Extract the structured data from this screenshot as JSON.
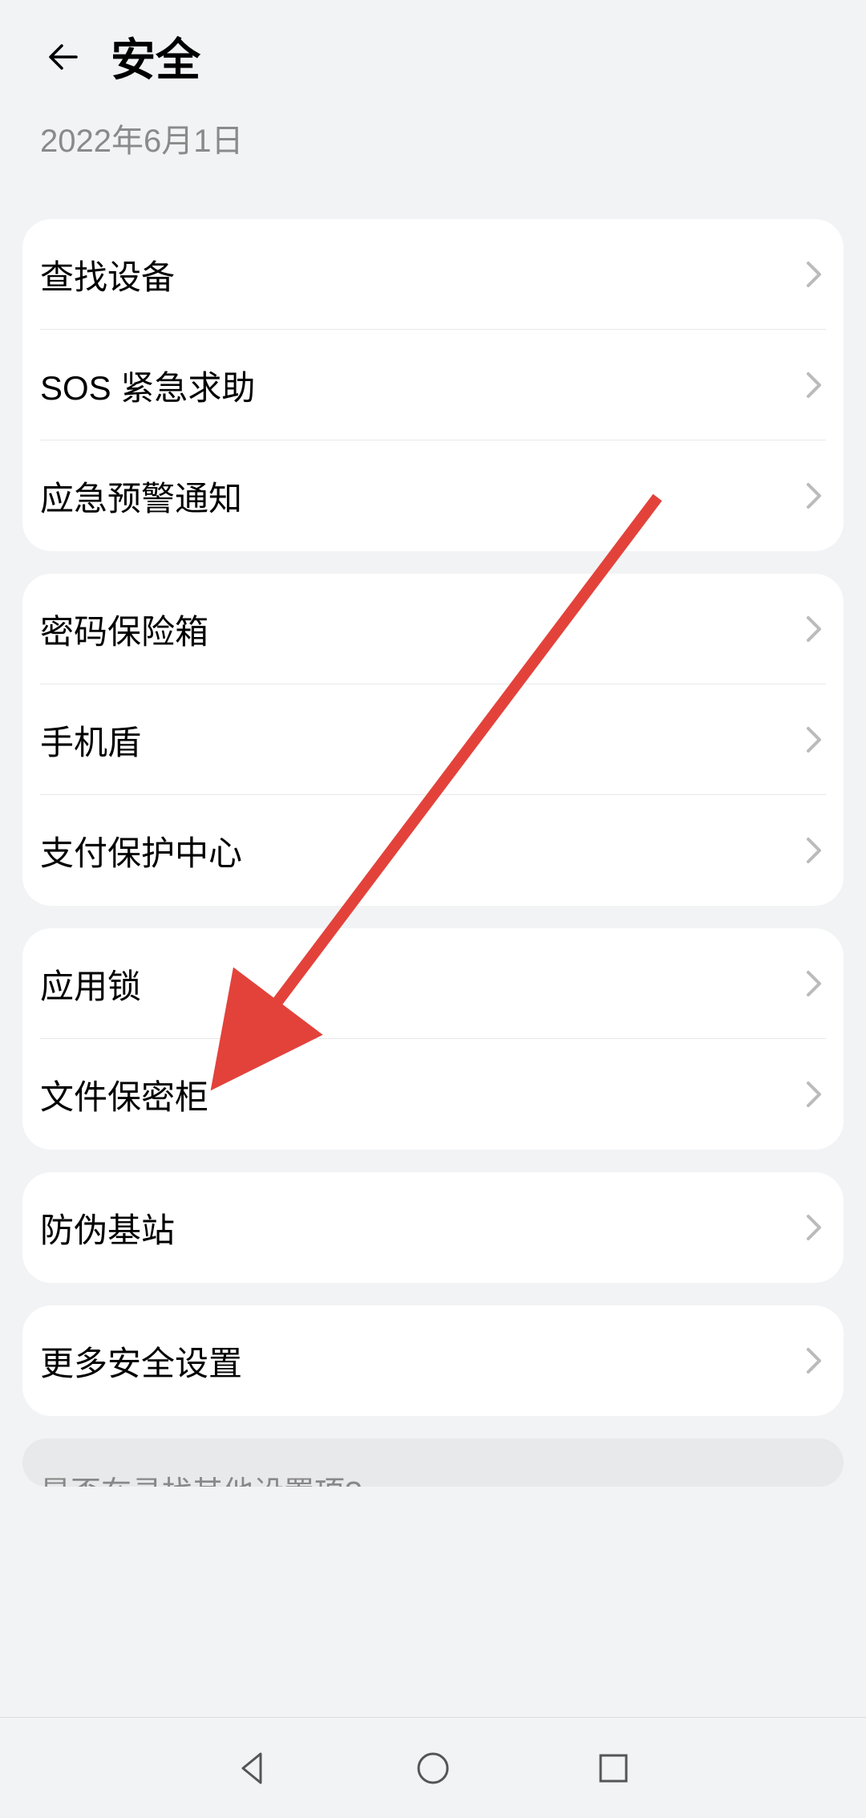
{
  "header": {
    "title": "安全",
    "date": "2022年6月1日"
  },
  "groups": [
    {
      "items": [
        {
          "label": "查找设备",
          "name": "find-device"
        },
        {
          "label": "SOS 紧急求助",
          "name": "sos-emergency"
        },
        {
          "label": "应急预警通知",
          "name": "emergency-alert"
        }
      ]
    },
    {
      "items": [
        {
          "label": "密码保险箱",
          "name": "password-vault"
        },
        {
          "label": "手机盾",
          "name": "phone-shield"
        },
        {
          "label": "支付保护中心",
          "name": "payment-protection"
        }
      ]
    },
    {
      "items": [
        {
          "label": "应用锁",
          "name": "app-lock"
        },
        {
          "label": "文件保密柜",
          "name": "file-safe"
        }
      ]
    },
    {
      "items": [
        {
          "label": "防伪基站",
          "name": "fake-base-station"
        }
      ]
    },
    {
      "items": [
        {
          "label": "更多安全设置",
          "name": "more-security-settings"
        }
      ]
    }
  ],
  "footer": {
    "more_text": "是否在寻找其他设置项?"
  },
  "annotation": {
    "arrow_color": "#e3423a"
  }
}
